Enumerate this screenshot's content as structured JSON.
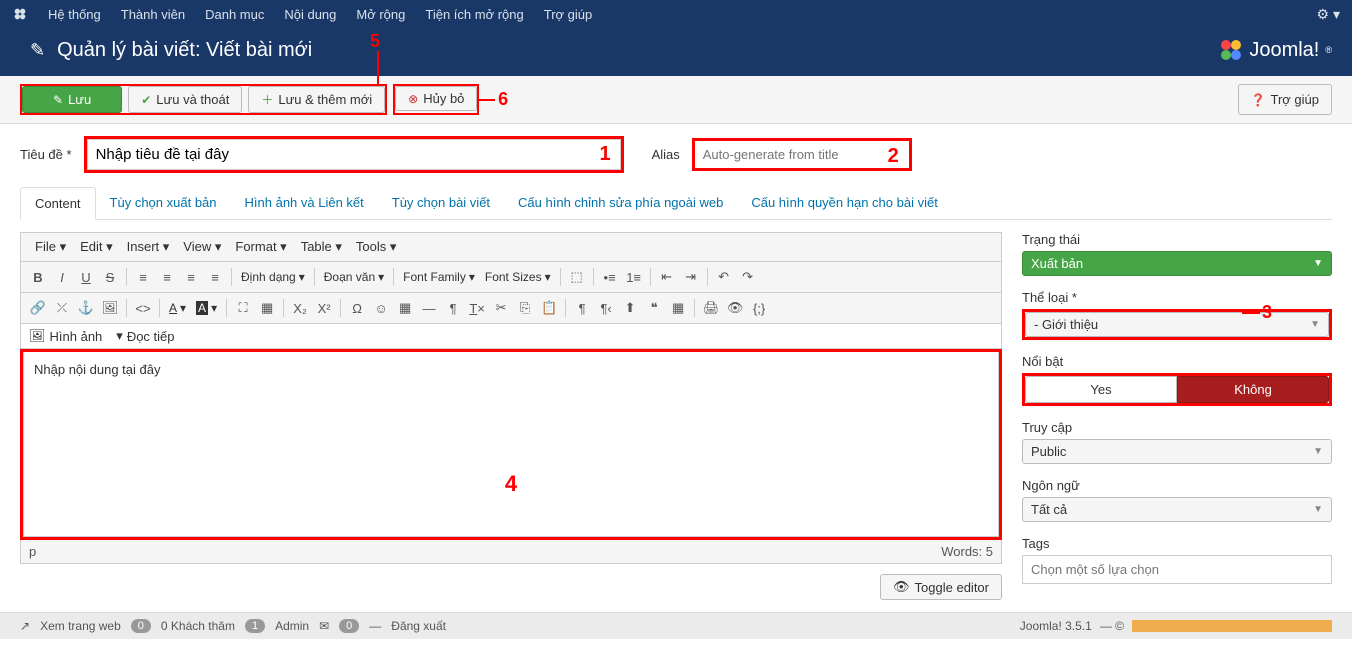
{
  "topnav": {
    "items": [
      "Hệ thống",
      "Thành viên",
      "Danh mục",
      "Nội dung",
      "Mở rộng",
      "Tiện ích mở rộng",
      "Trợ giúp"
    ]
  },
  "header": {
    "title": "Quản lý bài viết: Viết bài mới",
    "logo": "Joomla!"
  },
  "toolbar": {
    "save": "Lưu",
    "save_close": "Lưu và thoát",
    "save_new": "Lưu & thêm mới",
    "cancel": "Hủy bỏ",
    "help": "Trợ giúp"
  },
  "form": {
    "title_label": "Tiêu đề *",
    "title_value": "Nhập tiêu đề tại đây",
    "alias_label": "Alias",
    "alias_placeholder": "Auto-generate from title"
  },
  "tabs": [
    "Content",
    "Tùy chọn xuất bản",
    "Hình ảnh và Liên kết",
    "Tùy chọn bài viết",
    "Cấu hình chỉnh sửa phía ngoài web",
    "Cấu hình quyền hạn cho bài viết"
  ],
  "editor": {
    "menus": [
      "File",
      "Edit",
      "Insert",
      "View",
      "Format",
      "Table",
      "Tools"
    ],
    "format_sel": "Định dạng",
    "para_sel": "Đoạn văn",
    "font_family": "Font Family",
    "font_sizes": "Font Sizes",
    "image_btn": "Hình ảnh",
    "readmore_btn": "Đọc tiếp",
    "body": "Nhập nội dung tại đây",
    "status_path": "p",
    "status_words": "Words: 5",
    "toggle": "Toggle editor"
  },
  "side": {
    "status_label": "Trạng thái",
    "status_value": "Xuất bản",
    "category_label": "Thể loại *",
    "category_value": "- Giới thiệu",
    "featured_label": "Nổi bật",
    "featured_yes": "Yes",
    "featured_no": "Không",
    "access_label": "Truy cập",
    "access_value": "Public",
    "lang_label": "Ngôn ngữ",
    "lang_value": "Tất cả",
    "tags_label": "Tags",
    "tags_placeholder": "Chọn một số lựa chọn"
  },
  "footer": {
    "view_site": "Xem trang web",
    "visitors_count": "0",
    "visitors_label": "0 Khách thăm",
    "admin_count": "1",
    "admin_label": "Admin",
    "msg_count": "0",
    "logout": "Đăng xuất",
    "version": "Joomla! 3.5.1",
    "copyright": "— ©"
  },
  "annotations": {
    "n1": "1",
    "n2": "2",
    "n3": "3",
    "n4": "4",
    "n5": "5",
    "n6": "6"
  }
}
